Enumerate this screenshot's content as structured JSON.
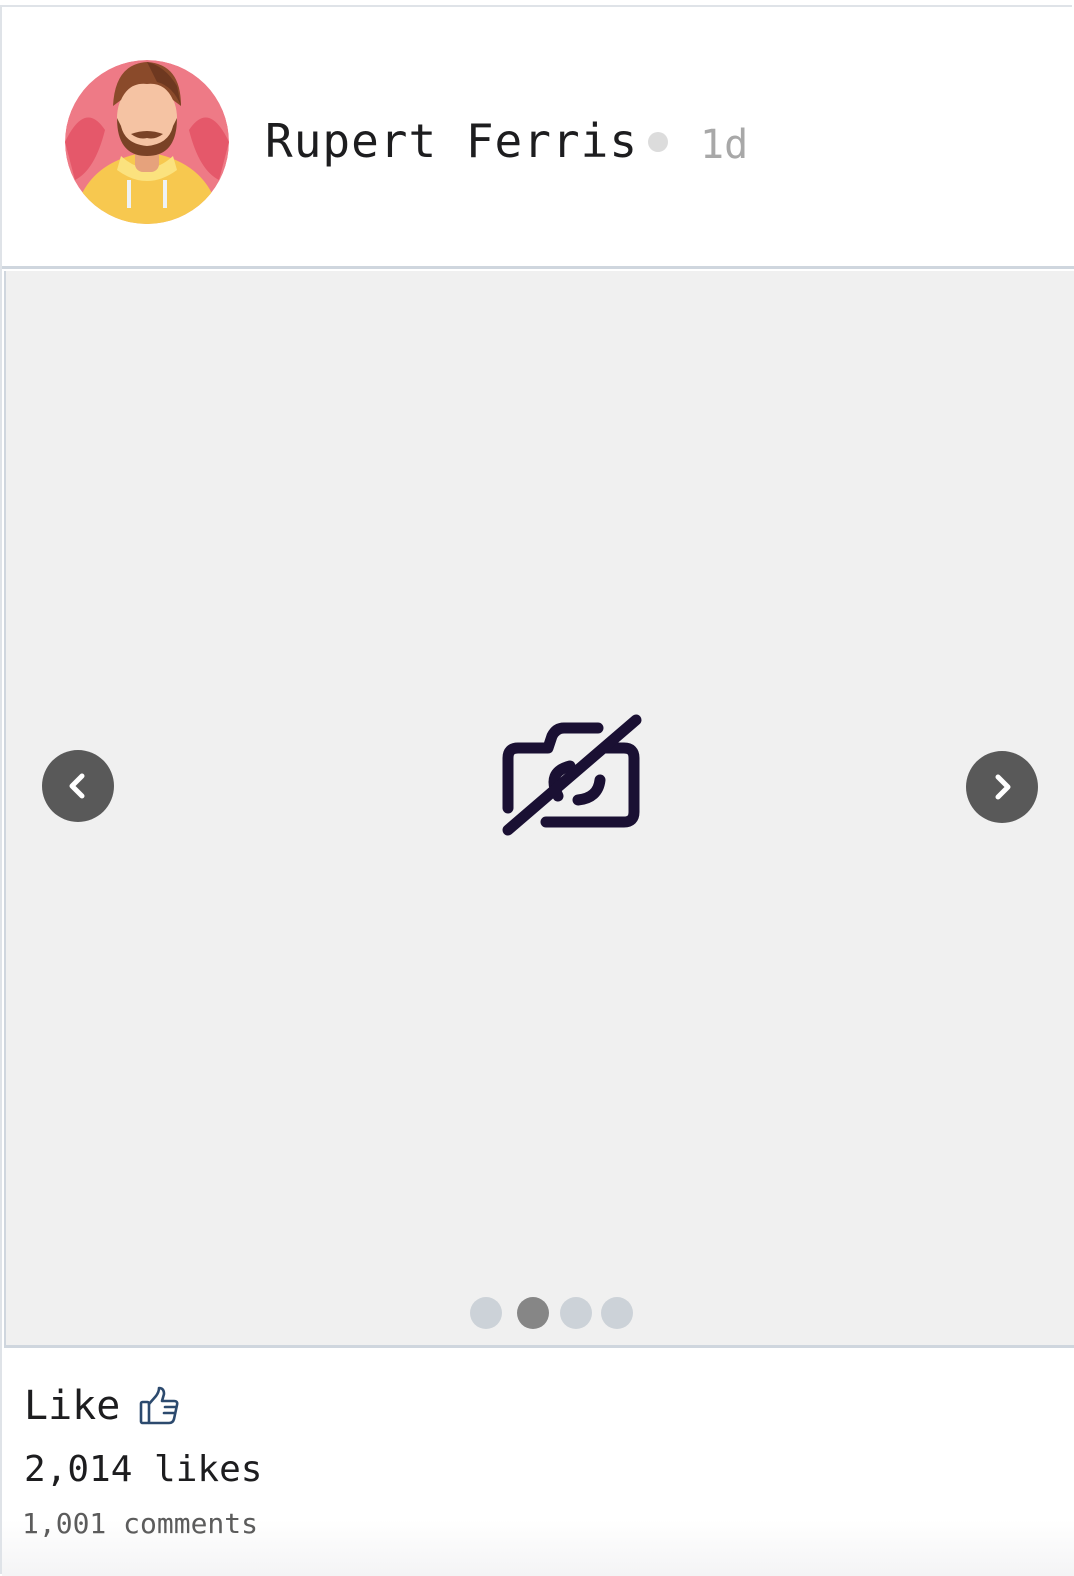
{
  "post": {
    "author": "Rupert Ferris",
    "time_ago": "1d",
    "avatar_icon": "bearded-man-avatar-icon",
    "media": {
      "placeholder_icon": "camera-off-icon",
      "prev_icon": "chevron-left-icon",
      "next_icon": "chevron-right-icon",
      "slide_count": 4,
      "active_slide": 2
    },
    "like_label": "Like",
    "like_icon": "thumbs-up-icon",
    "likes_text": "2,014 likes",
    "comments_text": "1,001 comments"
  },
  "colors": {
    "nav_button": "#595959",
    "media_background": "#f0f0f0",
    "placeholder_icon": "#1a1033",
    "dot_inactive": "#ccd2d8",
    "dot_active": "#868686",
    "thumb_icon": "#2c4a6e"
  }
}
